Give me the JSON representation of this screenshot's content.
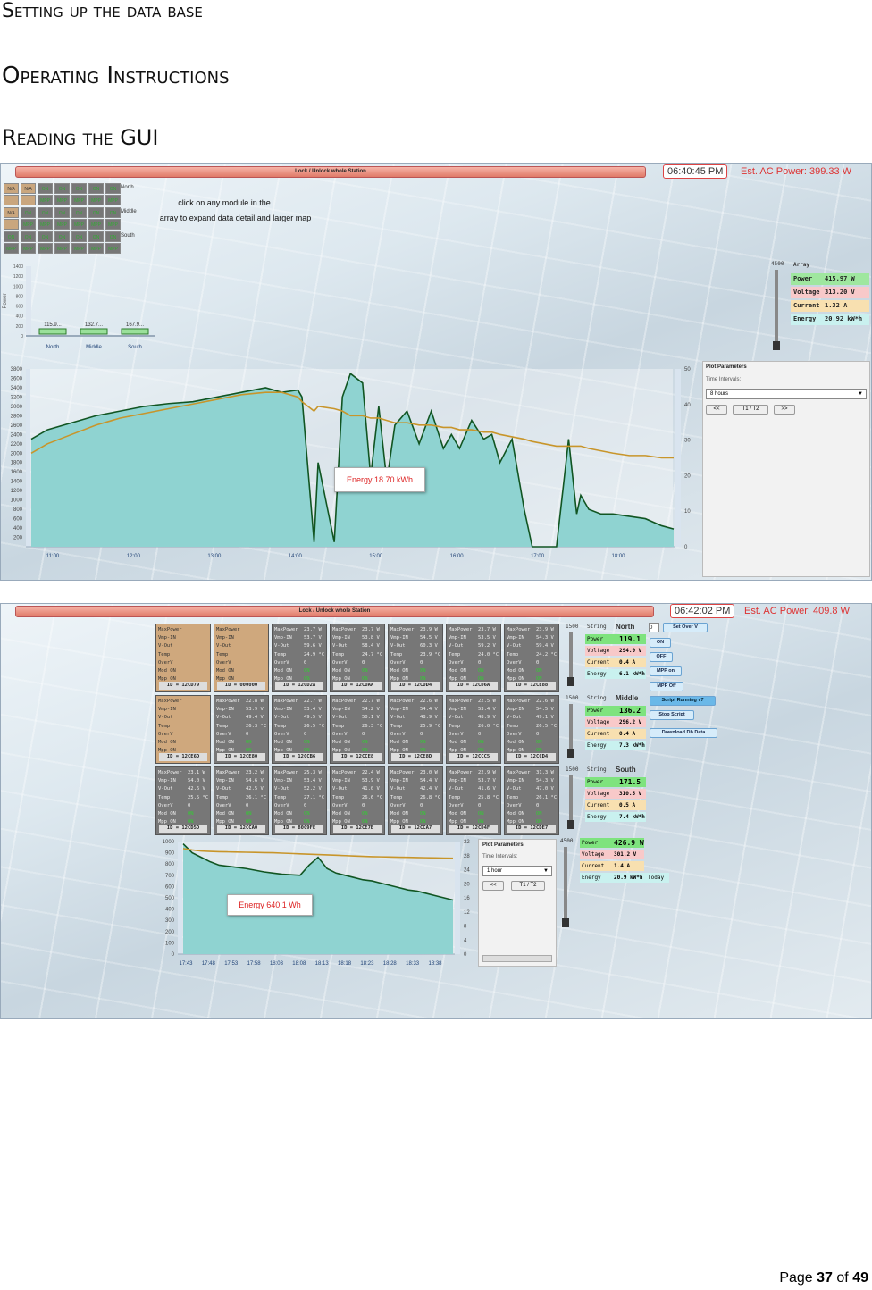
{
  "headings": {
    "h1": "Setting up the data base",
    "h2": "Operating Instructions",
    "h3": "Reading the GUI"
  },
  "shot1": {
    "lock_label": "Lock / Unlock whole Station",
    "clock": "06:40:45 PM",
    "est_ac": "Est. AC Power: 399.33 W",
    "grid_rows": [
      {
        "label": "North",
        "cells": [
          [
            "N/A",
            ""
          ],
          [
            "N/A",
            ""
          ],
          [
            "ON",
            "MPP"
          ],
          [
            "ON",
            "MPP"
          ],
          [
            "ON",
            "MPP"
          ],
          [
            "ON",
            "MPP"
          ],
          [
            "ON",
            "MPP"
          ]
        ]
      },
      {
        "label": "Middle",
        "cells": [
          [
            "N/A",
            ""
          ],
          [
            "ON",
            "MPP"
          ],
          [
            "ON",
            "MPP"
          ],
          [
            "ON",
            "MPP"
          ],
          [
            "ON",
            "MPP"
          ],
          [
            "ON",
            "MPP"
          ],
          [
            "ON",
            "MPP"
          ]
        ]
      },
      {
        "label": "South",
        "cells": [
          [
            "ON",
            "MPP"
          ],
          [
            "ON",
            "MPP"
          ],
          [
            "ON",
            "MPP"
          ],
          [
            "ON",
            "MPP"
          ],
          [
            "ON",
            "MPP"
          ],
          [
            "ON",
            "MPP"
          ],
          [
            "ON",
            "MPP"
          ]
        ]
      }
    ],
    "note_line1": "click on any module in the",
    "note_line2": "array to expand data detail and larger map",
    "bar_chart_ylabel": "Power",
    "slider_max": "4500",
    "array": {
      "title": "Array",
      "rows": [
        {
          "key": "Power",
          "value": "415.97 W",
          "color": "#9fe79f"
        },
        {
          "key": "Voltage",
          "value": "313.20 V",
          "color": "#f8c9c9"
        },
        {
          "key": "Current",
          "value": "1.32 A",
          "color": "#f8e0b0"
        },
        {
          "key": "Energy",
          "value": "20.92 kW*h",
          "color": "#c9f1ef"
        }
      ]
    },
    "plot_params": {
      "title": "Plot Parameters",
      "interval_label": "Time Intervals:",
      "interval_value": "8 hours",
      "btn_prev": "<<",
      "btn_t1t2": "T1 / T2",
      "btn_next": ">>"
    },
    "energy": "Energy 18.70 kWh"
  },
  "shot2": {
    "lock_label": "Lock / Unlock whole Station",
    "clock": "06:42:02 PM",
    "est_ac": "Est. AC Power: 409.8 W",
    "field_labels": [
      "MaxPower",
      "Vmp-IN",
      "V-Out",
      "Temp",
      "OverV",
      "Mod ON",
      "Mpp ON"
    ],
    "modules": [
      [
        {
          "na": true,
          "vals": [
            "",
            "",
            "",
            "",
            "",
            "",
            ""
          ],
          "id": "ID = 12CD79"
        },
        {
          "na": true,
          "vals": [
            "",
            "",
            "",
            "",
            "",
            "",
            ""
          ],
          "id": "ID = 000000"
        },
        {
          "na": false,
          "vals": [
            "23.7 W",
            "53.7 V",
            "59.6 V",
            "24.9 °C",
            "0",
            "ON",
            "ON"
          ],
          "id": "ID = 12CD2A"
        },
        {
          "na": false,
          "vals": [
            "23.7 W",
            "53.8 V",
            "58.4 V",
            "24.7 °C",
            "0",
            "ON",
            "ON"
          ],
          "id": "ID = 12CDAA"
        },
        {
          "na": false,
          "vals": [
            "23.9 W",
            "54.5 V",
            "60.3 V",
            "23.9 °C",
            "0",
            "ON",
            "ON"
          ],
          "id": "ID = 12CDD4"
        },
        {
          "na": false,
          "vals": [
            "23.7 W",
            "53.5 V",
            "59.2 V",
            "24.0 °C",
            "0",
            "ON",
            "ON"
          ],
          "id": "ID = 12CD6A"
        },
        {
          "na": false,
          "vals": [
            "23.9 W",
            "54.3 V",
            "59.4 V",
            "24.2 °C",
            "0",
            "ON",
            "ON"
          ],
          "id": "ID = 12CE88"
        }
      ],
      [
        {
          "na": true,
          "vals": [
            "",
            "",
            "",
            "",
            "",
            "",
            ""
          ],
          "id": "ID = 12CE6D"
        },
        {
          "na": false,
          "vals": [
            "22.8 W",
            "53.9 V",
            "49.4 V",
            "26.3 °C",
            "0",
            "ON",
            "ON"
          ],
          "id": "ID = 12CE80"
        },
        {
          "na": false,
          "vals": [
            "22.7 W",
            "53.4 V",
            "49.5 V",
            "26.5 °C",
            "0",
            "ON",
            "ON"
          ],
          "id": "ID = 12CCB6"
        },
        {
          "na": false,
          "vals": [
            "22.7 W",
            "54.2 V",
            "50.1 V",
            "26.3 °C",
            "0",
            "ON",
            "ON"
          ],
          "id": "ID = 12CCE8"
        },
        {
          "na": false,
          "vals": [
            "22.6 W",
            "54.4 V",
            "48.9 V",
            "25.9 °C",
            "0",
            "ON",
            "ON"
          ],
          "id": "ID = 12CE8D"
        },
        {
          "na": false,
          "vals": [
            "22.5 W",
            "53.4 V",
            "48.9 V",
            "26.0 °C",
            "0",
            "ON",
            "ON"
          ],
          "id": "ID = 12CCC5"
        },
        {
          "na": false,
          "vals": [
            "22.6 W",
            "54.5 V",
            "49.1 V",
            "26.5 °C",
            "0",
            "ON",
            "ON"
          ],
          "id": "ID = 12CCD4"
        }
      ],
      [
        {
          "na": false,
          "vals": [
            "23.1 W",
            "54.0 V",
            "42.6 V",
            "25.5 °C",
            "0",
            "ON",
            "ON"
          ],
          "id": "ID = 12CD5D"
        },
        {
          "na": false,
          "vals": [
            "23.2 W",
            "54.6 V",
            "42.5 V",
            "26.1 °C",
            "0",
            "ON",
            "ON"
          ],
          "id": "ID = 12CCA0"
        },
        {
          "na": false,
          "vals": [
            "25.3 W",
            "53.4 V",
            "52.2 V",
            "27.1 °C",
            "0",
            "ON",
            "ON"
          ],
          "id": "ID = 80C9FE"
        },
        {
          "na": false,
          "vals": [
            "22.4 W",
            "53.9 V",
            "41.0 V",
            "26.6 °C",
            "0",
            "ON",
            "ON"
          ],
          "id": "ID = 12CE7B"
        },
        {
          "na": false,
          "vals": [
            "23.0 W",
            "54.4 V",
            "42.4 V",
            "26.8 °C",
            "0",
            "ON",
            "ON"
          ],
          "id": "ID = 12CCA7"
        },
        {
          "na": false,
          "vals": [
            "22.9 W",
            "53.7 V",
            "41.6 V",
            "25.8 °C",
            "0",
            "ON",
            "ON"
          ],
          "id": "ID = 12CD4F"
        },
        {
          "na": false,
          "vals": [
            "31.3 W",
            "54.3 V",
            "47.0 V",
            "26.1 °C",
            "0",
            "ON",
            "ON"
          ],
          "id": "ID = 12CDE7"
        }
      ]
    ],
    "string_label": "String",
    "slider_max": "1500",
    "strings": [
      {
        "name": "North",
        "power": "119.1 W",
        "voltage": "294.9 V",
        "current": "0.4 A",
        "energy": "6.1 kW*h"
      },
      {
        "name": "Middle",
        "power": "136.2 W",
        "voltage": "296.2 V",
        "current": "0.4 A",
        "energy": "7.3 kW*h"
      },
      {
        "name": "South",
        "power": "171.5 W",
        "voltage": "310.5 V",
        "current": "0.5 A",
        "energy": "7.4 kW*h"
      }
    ],
    "row_keys": {
      "power": "Power",
      "voltage": "Voltage",
      "current": "Current",
      "energy": "Energy"
    },
    "set_input": "0",
    "buttons": {
      "set_over_v": "Set Over V",
      "on": "ON",
      "off": "OFF",
      "mpp_on": "MPP on",
      "mpp_off": "MPP Off",
      "script_running": "Script Running v7",
      "stop_script": "Stop Script",
      "download": "Download Db Data"
    },
    "total": {
      "slider_max": "4500",
      "power": "426.9 W",
      "voltage": "301.2 V",
      "current": "1.4 A",
      "energy": "20.9 kW*h",
      "energy_tag": "Today"
    },
    "plot_params": {
      "title": "Plot Parameters",
      "interval_label": "Time Intervals:",
      "interval_value": "1 hour",
      "btn_prev": "<<",
      "btn_t1t2": "T1 / T2"
    },
    "energy": "Energy 640.1 Wh"
  },
  "chart_data": [
    {
      "type": "bar",
      "ylabel": "Power",
      "categories": [
        "North",
        "Middle",
        "South"
      ],
      "values": [
        115.9,
        132.7,
        167.9
      ],
      "value_labels": [
        "115.9...",
        "132.7...",
        "167.9..."
      ],
      "yticks": [
        "1400",
        "1200",
        "1000",
        "800",
        "600",
        "400",
        "200",
        "0"
      ],
      "ylim": [
        0,
        1400
      ]
    },
    {
      "type": "area",
      "xticks": [
        "11:00",
        "12:00",
        "13:00",
        "14:00",
        "15:00",
        "16:00",
        "17:00",
        "18:00"
      ],
      "yticks": [
        "3800",
        "3600",
        "3400",
        "3200",
        "3000",
        "2800",
        "2600",
        "2400",
        "2200",
        "2000",
        "1800",
        "1600",
        "1400",
        "1200",
        "1000",
        "800",
        "600",
        "400",
        "200"
      ],
      "y2ticks": [
        "50",
        "40",
        "30",
        "20",
        "10",
        "0"
      ],
      "ylim": [
        0,
        3800
      ],
      "y2lim": [
        0,
        50
      ],
      "x_hours": [
        10.8,
        11.0,
        11.3,
        11.6,
        11.9,
        12.2,
        12.5,
        12.8,
        13.1,
        13.4,
        13.7,
        13.9,
        14.1,
        14.15,
        14.3,
        14.35,
        14.55,
        14.65,
        14.75,
        14.9,
        15.0,
        15.1,
        15.2,
        15.3,
        15.45,
        15.6,
        15.75,
        15.9,
        16.0,
        16.1,
        16.25,
        16.4,
        16.5,
        16.6,
        16.75,
        16.9,
        17.0,
        17.15,
        17.3,
        17.45,
        17.55,
        17.6,
        17.7,
        17.85,
        18.0,
        18.2,
        18.4,
        18.6,
        18.75
      ],
      "power": [
        2300,
        2500,
        2650,
        2800,
        2900,
        3000,
        3060,
        3100,
        3200,
        3300,
        3400,
        3300,
        3350,
        3200,
        100,
        1800,
        100,
        3200,
        3700,
        3500,
        1500,
        3000,
        1400,
        2600,
        2900,
        2200,
        2900,
        2100,
        2400,
        2100,
        2700,
        2300,
        2400,
        1800,
        2300,
        800,
        0,
        0,
        0,
        2300,
        700,
        1100,
        800,
        700,
        700,
        650,
        600,
        450,
        380
      ],
      "energy_overlay": [
        2000,
        2200,
        2400,
        2600,
        2750,
        2850,
        2950,
        3050,
        3150,
        3250,
        3300,
        3300,
        3200,
        3100,
        2900,
        3000,
        2950,
        2900,
        2800,
        2800,
        2750,
        2750,
        2700,
        2650,
        2650,
        2600,
        2600,
        2550,
        2550,
        2500,
        2500,
        2450,
        2450,
        2400,
        2350,
        2300,
        2250,
        2200,
        2150,
        2150,
        2150,
        2150,
        2100,
        2050,
        2000,
        1950,
        1950,
        1900,
        1900
      ]
    },
    {
      "type": "area",
      "xticks": [
        "17:43",
        "17:48",
        "17:53",
        "17:58",
        "18:03",
        "18:08",
        "18:13",
        "18:18",
        "18:23",
        "18:28",
        "18:33",
        "18:38"
      ],
      "yticks": [
        "1000",
        "900",
        "800",
        "700",
        "600",
        "500",
        "400",
        "300",
        "200",
        "100",
        "0"
      ],
      "y2ticks": [
        "32",
        "28",
        "24",
        "20",
        "16",
        "12",
        "8",
        "4",
        "0"
      ],
      "ylim": [
        0,
        1000
      ],
      "y2lim": [
        0,
        32
      ],
      "x_min": [
        0,
        2,
        4,
        6,
        8,
        10,
        12,
        14,
        16,
        18,
        20,
        22,
        24,
        26,
        28,
        30,
        32,
        34,
        36,
        38,
        40,
        42,
        44,
        46,
        48,
        50,
        52,
        54,
        56,
        58,
        60
      ],
      "power": [
        980,
        900,
        860,
        820,
        790,
        780,
        770,
        760,
        745,
        730,
        720,
        710,
        705,
        700,
        790,
        860,
        760,
        720,
        700,
        680,
        660,
        650,
        630,
        610,
        590,
        570,
        560,
        540,
        520,
        500,
        480
      ],
      "energy_overlay": [
        30,
        29.6,
        29.3,
        29.2,
        29.1,
        29.05,
        29.0,
        28.95,
        28.9,
        28.85,
        28.8,
        28.7,
        28.6,
        28.5,
        28.4,
        28.3,
        28.2,
        28.1,
        28.0,
        27.9,
        27.8,
        27.7,
        27.65,
        27.6,
        27.55,
        27.5,
        27.45,
        27.4,
        27.35,
        27.3,
        27.25
      ]
    }
  ],
  "footer": {
    "prefix": "Page",
    "page": "37",
    "of": "of",
    "total": "49"
  }
}
